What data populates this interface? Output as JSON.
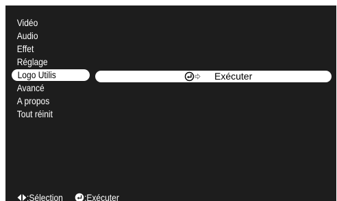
{
  "menu": {
    "items": [
      {
        "label": "Vidéo",
        "selected": false
      },
      {
        "label": "Audio",
        "selected": false
      },
      {
        "label": "Effet",
        "selected": false
      },
      {
        "label": "Réglage",
        "selected": false
      },
      {
        "label": "Logo Utilis",
        "selected": true
      },
      {
        "label": "Avancé",
        "selected": false
      },
      {
        "label": "A propos",
        "selected": false
      },
      {
        "label": "Tout réinit",
        "selected": false
      }
    ]
  },
  "submenu": {
    "icon": "enter-icon",
    "label": "Exécuter"
  },
  "footer": {
    "selection_icon": "left-right-arrows-icon",
    "selection_label": ":Sélection",
    "execute_icon": "enter-icon",
    "execute_label": ":Exécuter"
  },
  "colors": {
    "osd_background": "#1d1d1d",
    "highlight": "#ffffff",
    "text": "#ffffff",
    "highlight_text": "#000000"
  }
}
